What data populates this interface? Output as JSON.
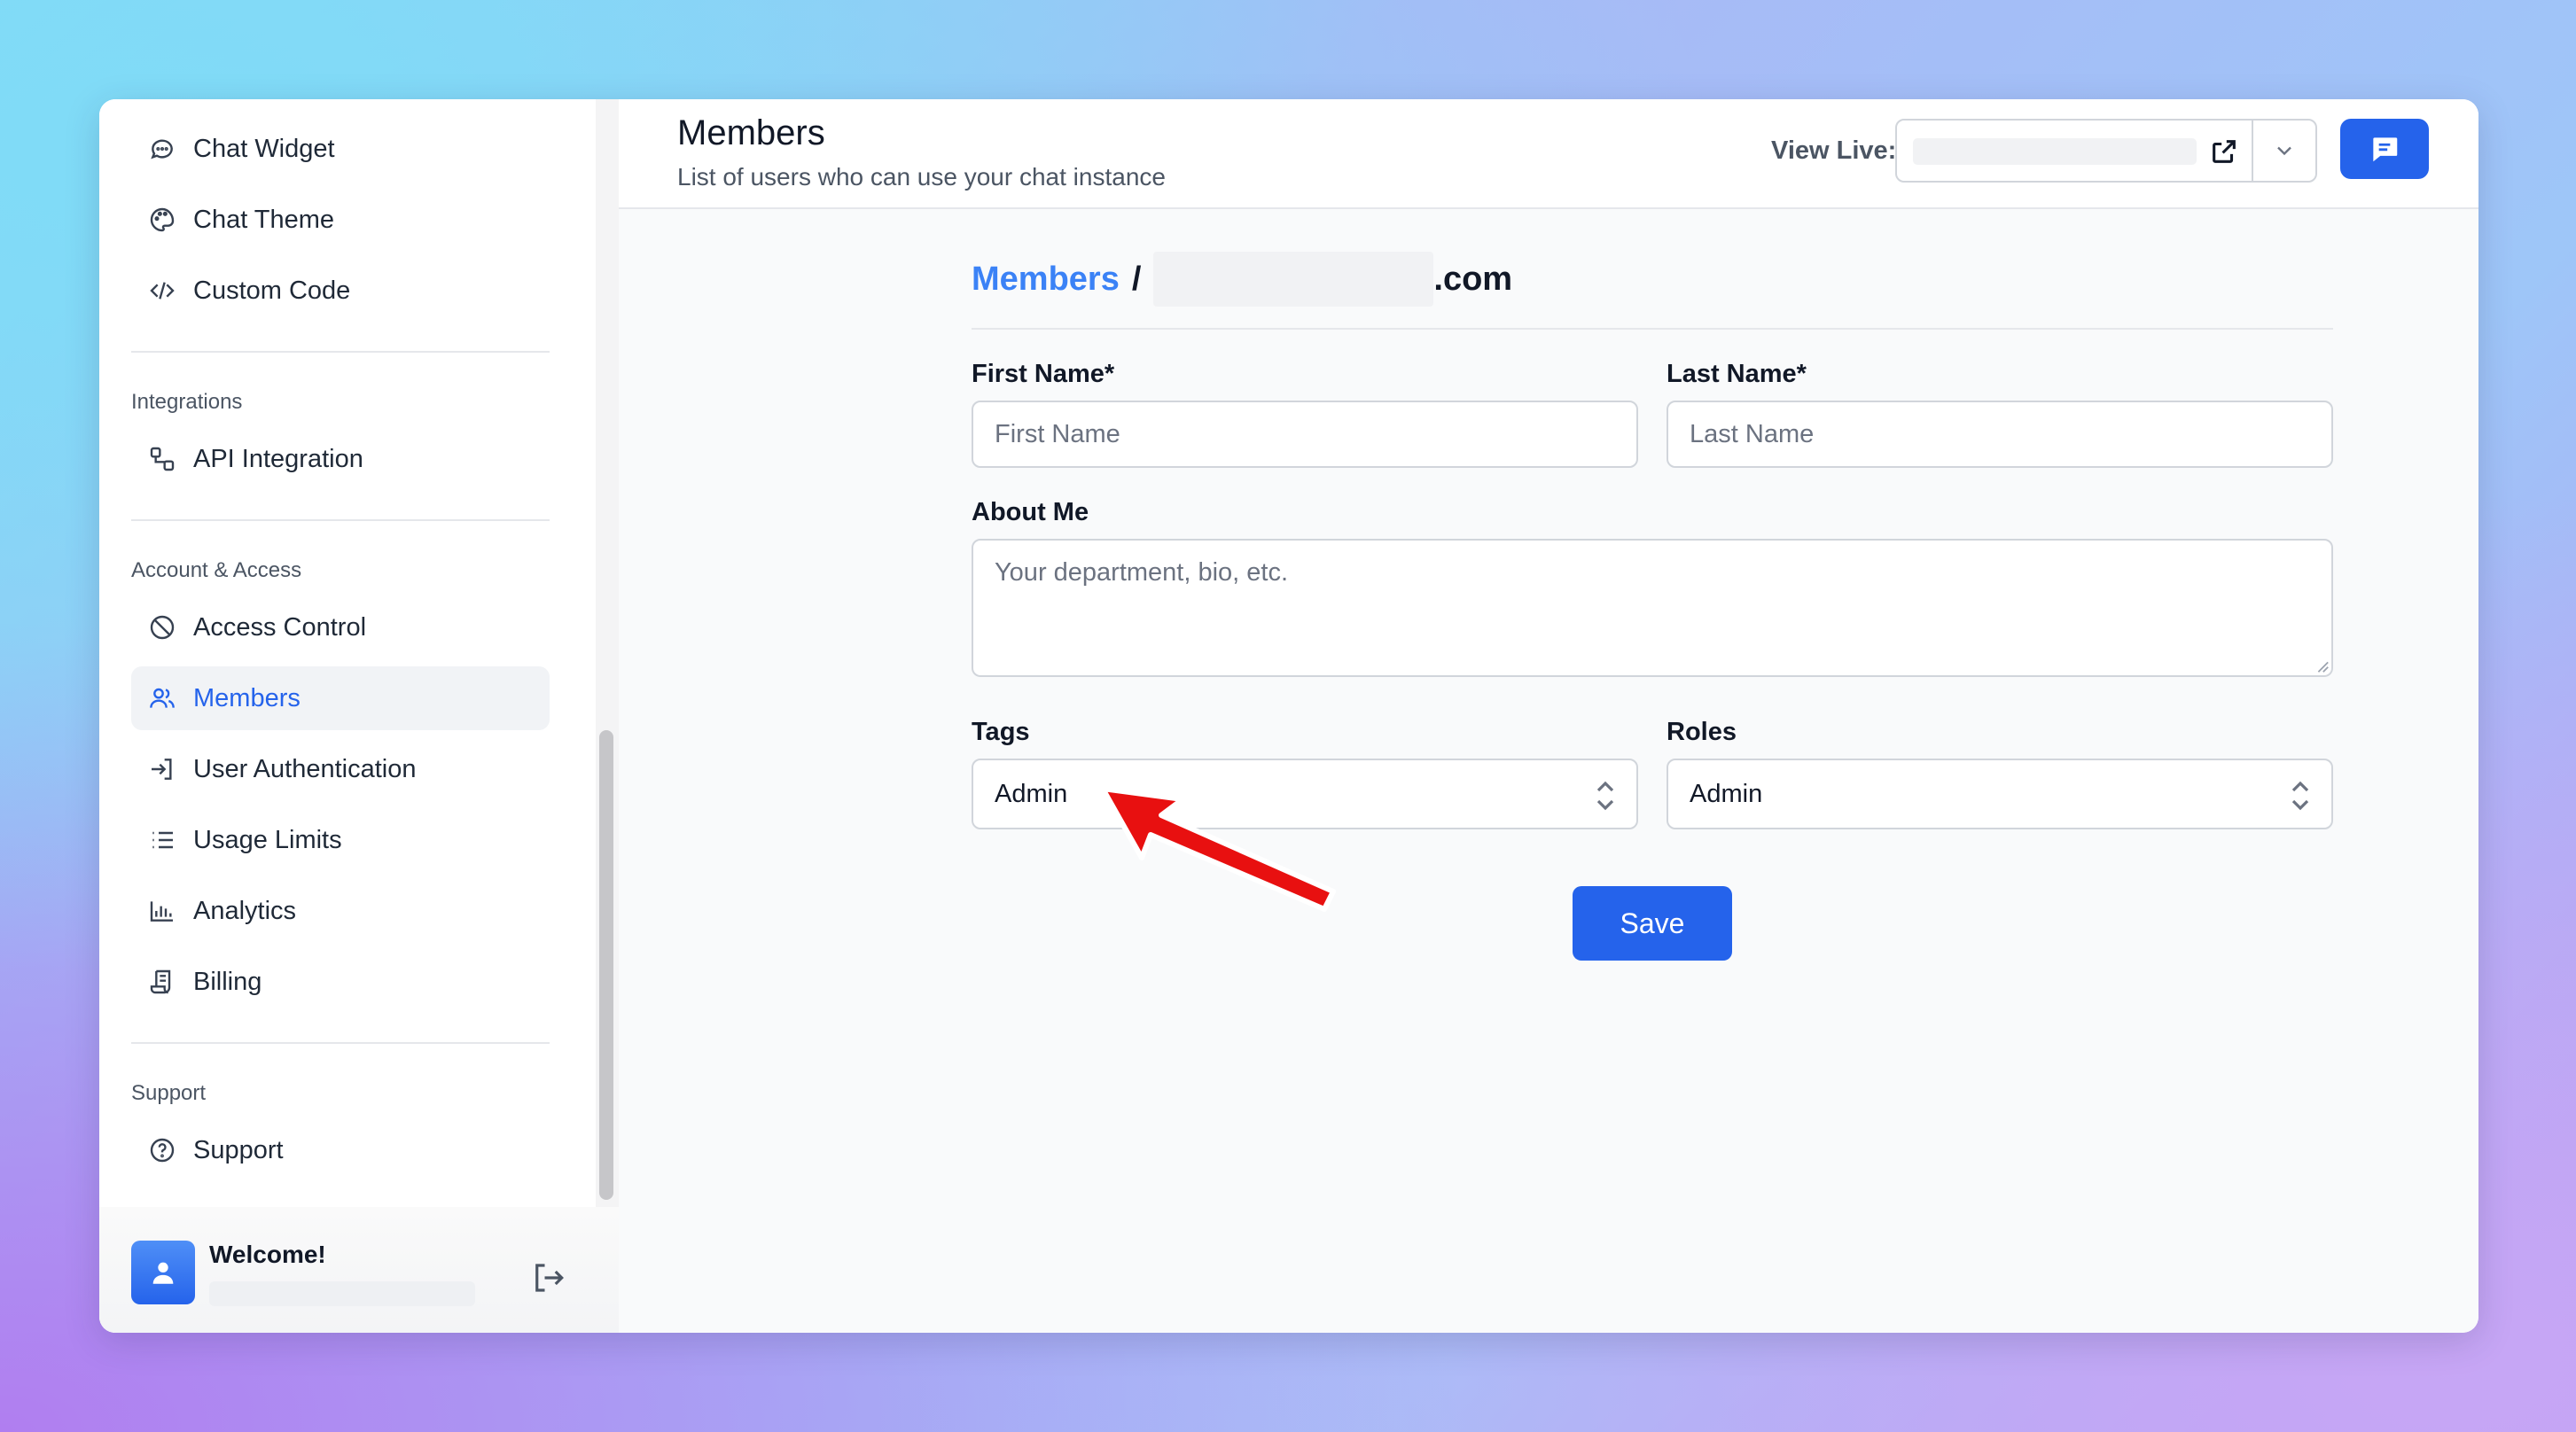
{
  "sidebar": {
    "items_top": [
      {
        "label": "Chat Widget",
        "icon": "chat-bubble-icon"
      },
      {
        "label": "Chat Theme",
        "icon": "palette-icon"
      },
      {
        "label": "Custom Code",
        "icon": "code-icon"
      }
    ],
    "integrations_label": "Integrations",
    "integrations": [
      {
        "label": "API Integration",
        "icon": "api-icon"
      }
    ],
    "account_label": "Account & Access",
    "account": [
      {
        "label": "Access Control",
        "icon": "ban-icon"
      },
      {
        "label": "Members",
        "icon": "users-icon",
        "active": true
      },
      {
        "label": "User Authentication",
        "icon": "login-icon"
      },
      {
        "label": "Usage Limits",
        "icon": "list-icon"
      },
      {
        "label": "Analytics",
        "icon": "bar-chart-icon"
      },
      {
        "label": "Billing",
        "icon": "receipt-icon"
      }
    ],
    "support_label": "Support",
    "support": [
      {
        "label": "Support",
        "icon": "help-circle-icon"
      }
    ],
    "user": {
      "welcome": "Welcome!"
    }
  },
  "header": {
    "title": "Members",
    "subtitle": "List of users who can use your chat instance",
    "view_live_label": "View Live:"
  },
  "form": {
    "breadcrumb_link": "Members",
    "breadcrumb_sep": "/",
    "breadcrumb_domain": ".com",
    "first_name_label": "First Name*",
    "first_name_placeholder": "First Name",
    "last_name_label": "Last Name*",
    "last_name_placeholder": "Last Name",
    "about_label": "About Me",
    "about_placeholder": "Your department, bio, etc.",
    "tags_label": "Tags",
    "tags_value": "Admin",
    "roles_label": "Roles",
    "roles_value": "Admin",
    "save_label": "Save"
  },
  "colors": {
    "accent": "#2563eb",
    "link": "#3b82f6",
    "annotation_arrow": "#e81010"
  }
}
